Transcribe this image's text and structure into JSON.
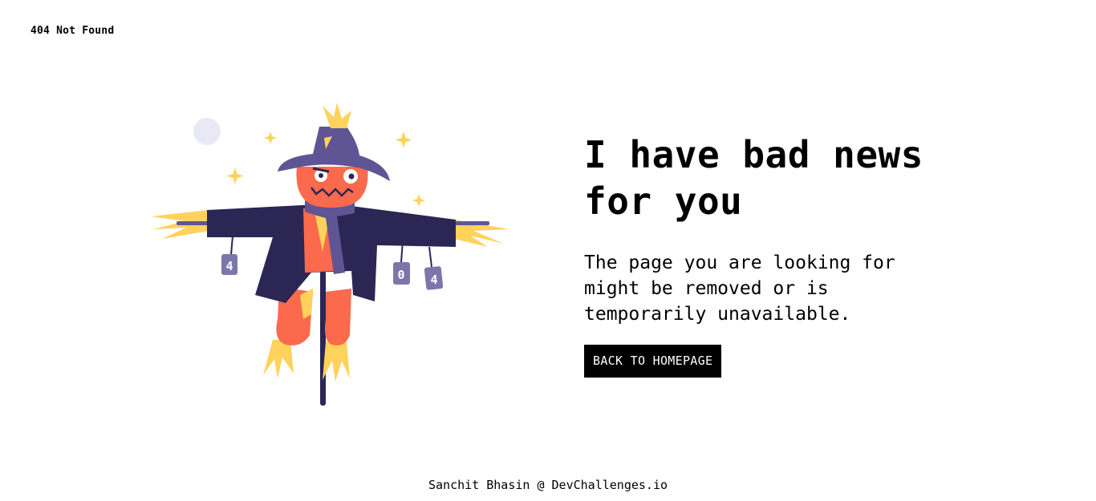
{
  "header": {
    "brand": "404 Not Found"
  },
  "illustration": {
    "can_digits": [
      "4",
      "0",
      "4"
    ],
    "colors": {
      "hat": "#5f5595",
      "coat": "#2b2653",
      "face": "#fb6a4c",
      "straw": "#ffd25b",
      "moon": "#e8e9f5",
      "can": "#7c76ab"
    }
  },
  "main": {
    "headline": "I have bad news for you",
    "message": "The page you are looking for might be removed or is temporarily unavailable.",
    "button_label": "BACK TO HOMEPAGE"
  },
  "footer": {
    "credit": "Sanchit Bhasin @ DevChallenges.io"
  }
}
